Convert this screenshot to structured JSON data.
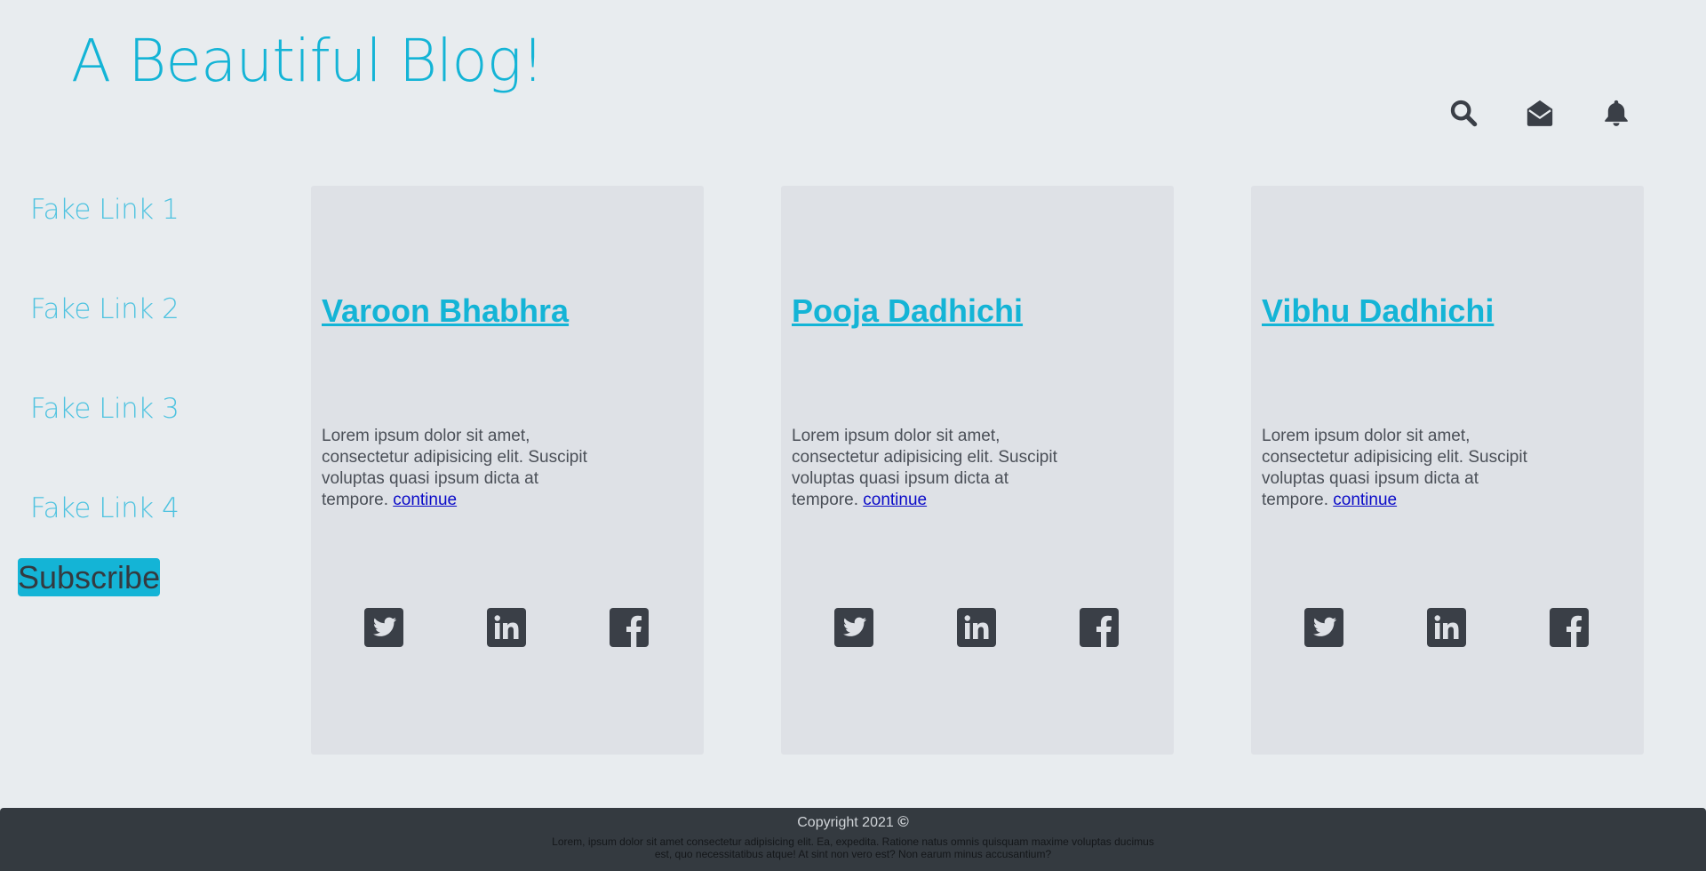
{
  "header": {
    "title": "A Beautiful Blog!",
    "icons": [
      "search-icon",
      "envelope-open-icon",
      "bell-icon"
    ]
  },
  "sidebar": {
    "links": [
      "Fake Link 1",
      "Fake Link 2",
      "Fake Link 3",
      "Fake Link 4"
    ],
    "subscribe_label": "Subscribe"
  },
  "cards": [
    {
      "name": "Varoon Bhabhra",
      "text": "Lorem ipsum dolor sit amet, consectetur adipisicing elit. Suscipit voluptas quasi ipsum dicta at tempore.",
      "link": "continue"
    },
    {
      "name": "Pooja Dadhichi",
      "text": "Lorem ipsum dolor sit amet, consectetur adipisicing elit. Suscipit voluptas quasi ipsum dicta at tempore.",
      "link": "continue"
    },
    {
      "name": "Vibhu Dadhichi",
      "text": "Lorem ipsum dolor sit amet, consectetur adipisicing elit. Suscipit voluptas quasi ipsum dicta at tempore.",
      "link": "continue"
    }
  ],
  "social_icons": [
    "twitter-icon",
    "linkedin-icon",
    "facebook-icon"
  ],
  "footer": {
    "copyright": "Copyright 2021",
    "copyright_symbol": "©",
    "text": "Lorem, ipsum dolor sit amet consectetur adipisicing elit. Ea, expedita. Ratione natus omnis quisquam maxime voluptas ducimus est, quo necessitatibus atque! At sint non vero est? Non earum minus accusantium?"
  },
  "colors": {
    "background": "#e8ecef",
    "card": "#dee1e6",
    "accent": "#14b4d6",
    "icon": "#3a3f47",
    "footer": "#343a40",
    "link": "#0b0bc8"
  }
}
